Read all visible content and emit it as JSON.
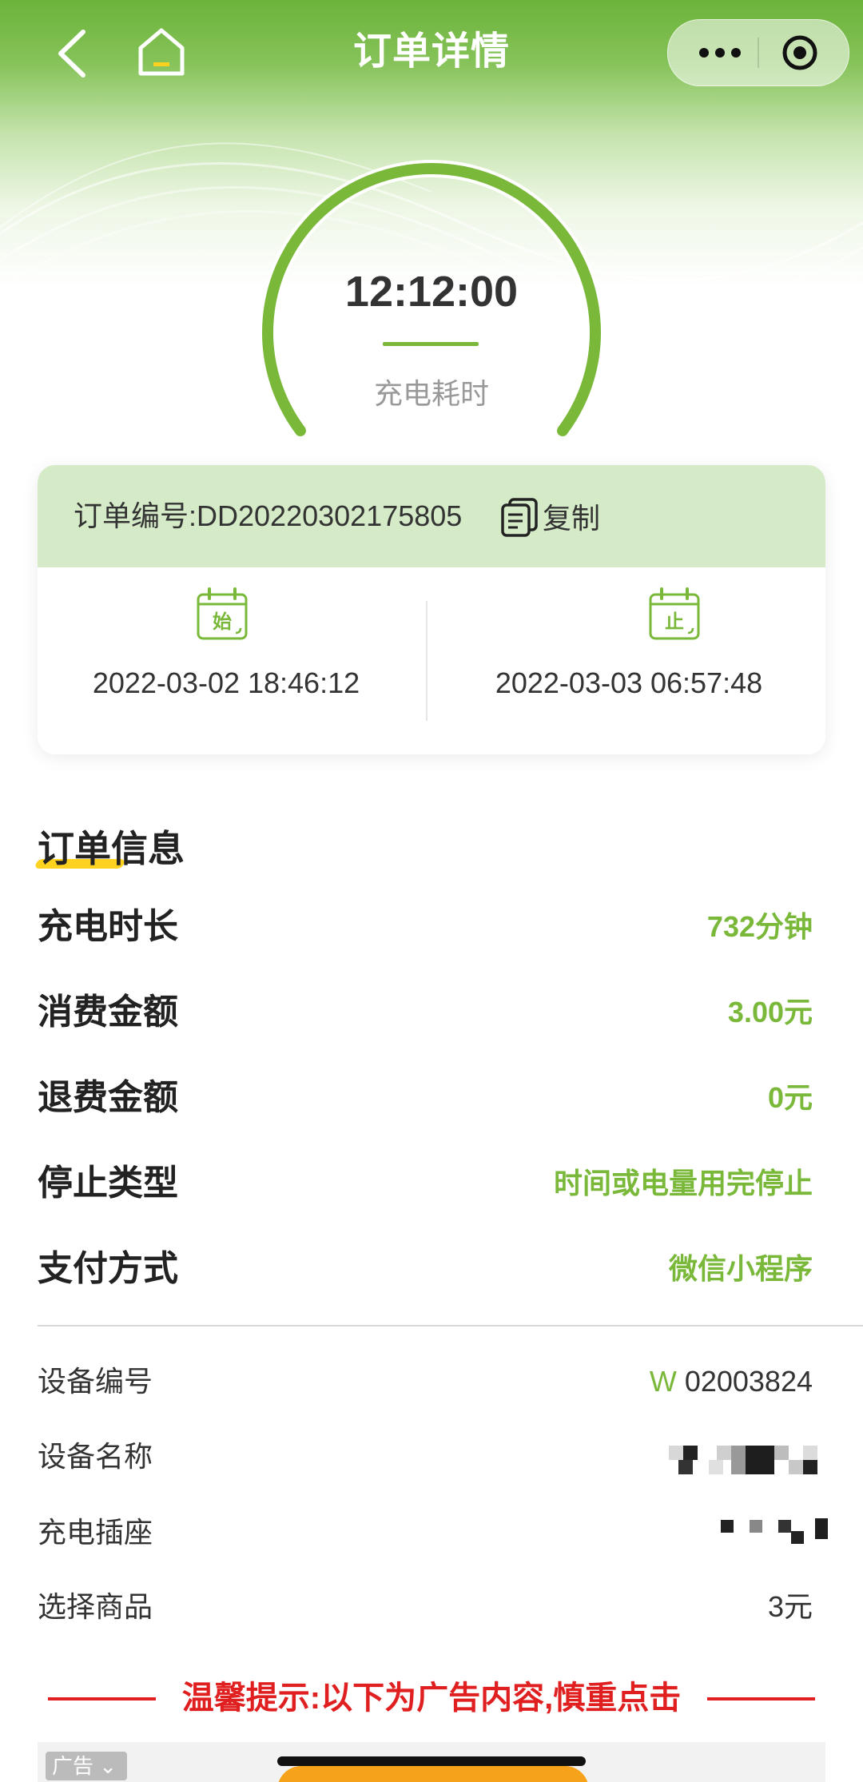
{
  "nav": {
    "title": "订单详情",
    "back_icon": "chevron-left-icon",
    "home_icon": "home-icon",
    "more_icon": "more-dots-icon",
    "close_icon": "target-circle-icon"
  },
  "gauge": {
    "value": "12:12:00",
    "label": "充电耗时",
    "color": "#7ab83a"
  },
  "order": {
    "number_text": "订单编号:DD20220302175805",
    "copy_label": "复制",
    "start_icon_char": "始",
    "end_icon_char": "止",
    "start_time": "2022-03-02 18:46:12",
    "end_time": "2022-03-03 06:57:48"
  },
  "section": {
    "title": "订单信息"
  },
  "info": [
    {
      "label": "充电时长",
      "value": "732分钟"
    },
    {
      "label": "消费金额",
      "value": "3.00元"
    },
    {
      "label": "退费金额",
      "value": "0元"
    },
    {
      "label": "停止类型",
      "value": "时间或电量用完停止"
    },
    {
      "label": "支付方式",
      "value": "微信小程序"
    }
  ],
  "device": {
    "number_label": "设备编号",
    "number_prefix": "W",
    "number_value": "02003824",
    "name_label": "设备名称",
    "socket_label": "充电插座",
    "product_label": "选择商品",
    "product_value": "3元"
  },
  "notice": {
    "text": "温馨提示:以下为广告内容,慎重点击"
  },
  "ad": {
    "tag": "广告 ⌄"
  },
  "colors": {
    "accent": "#7ab83a",
    "header_green": "#6cb33a",
    "order_head_bg": "#d5ebc7",
    "warning_red": "#e02020",
    "highlight_yellow": "#ffd21f"
  }
}
